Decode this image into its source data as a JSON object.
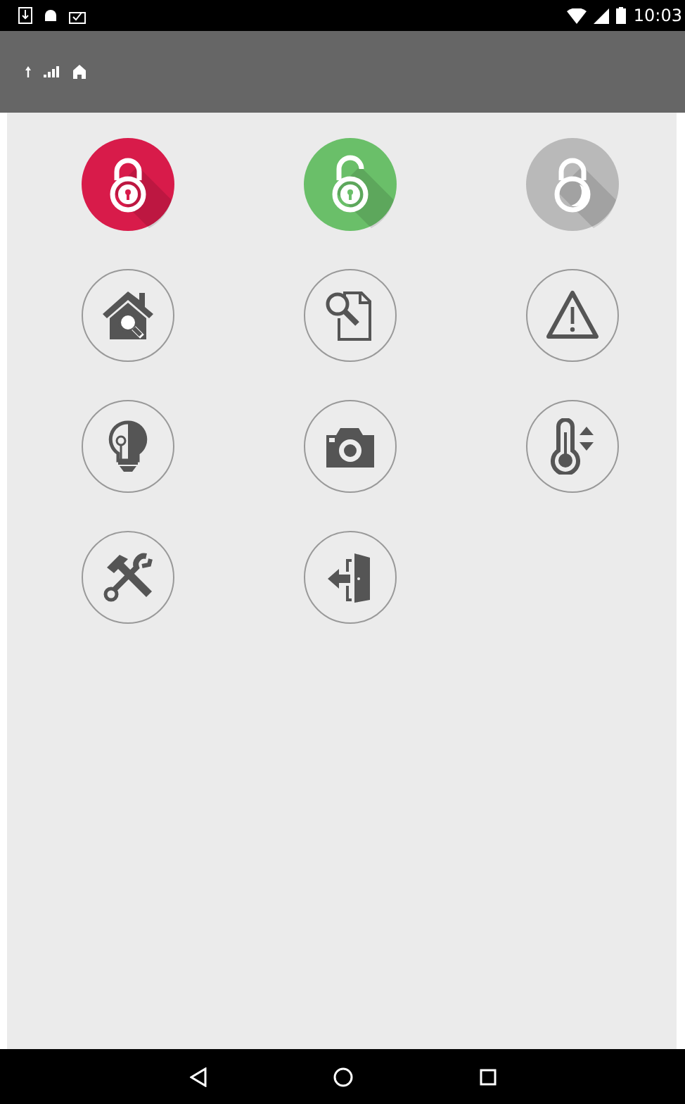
{
  "status_bar": {
    "time": "10:03"
  },
  "tiles": [
    {
      "kind": "locked",
      "color": "#d81b4a"
    },
    {
      "kind": "unlocked",
      "color": "#6abf69"
    },
    {
      "kind": "inactive",
      "color": "#b9b9b9"
    },
    {
      "kind": "house"
    },
    {
      "kind": "document"
    },
    {
      "kind": "warning"
    },
    {
      "kind": "light"
    },
    {
      "kind": "camera"
    },
    {
      "kind": "thermostat"
    },
    {
      "kind": "tools"
    },
    {
      "kind": "exit"
    }
  ]
}
